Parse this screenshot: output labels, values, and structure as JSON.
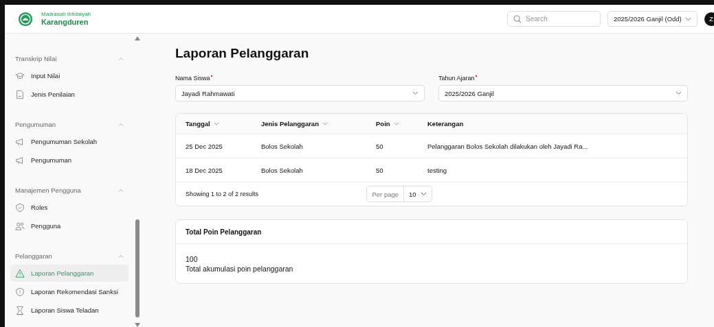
{
  "brand": {
    "line_1": "Madrasah Ibtidaiyah",
    "line_2": "Karangduren"
  },
  "header": {
    "search": {
      "placeholder": "Search"
    },
    "period": "2025/2026 Ganjil (Odd)",
    "avatar": "Z"
  },
  "sidebar": {
    "groups": [
      {
        "title": "Transkrip Nilai",
        "expanded": true,
        "items": [
          {
            "label": "Input Nilai",
            "selected": false
          },
          {
            "label": "Jenis Penilaian",
            "selected": false
          }
        ]
      },
      {
        "title": "Pengumuman",
        "expanded": true,
        "items": [
          {
            "label": "Pengumuman Sekolah",
            "selected": false
          },
          {
            "label": "Pengumuman",
            "selected": false
          }
        ]
      },
      {
        "title": "Manajemen Pengguna",
        "expanded": true,
        "items": [
          {
            "label": "Roles",
            "selected": false
          },
          {
            "label": "Pengguna",
            "selected": false
          }
        ]
      },
      {
        "title": "Pelanggaran",
        "expanded": true,
        "items": [
          {
            "label": "Laporan Pelanggaran",
            "selected": true
          },
          {
            "label": "Laporan Rekomendasi Sanksi",
            "selected": false
          },
          {
            "label": "Laporan Siswa Teladan",
            "selected": false
          }
        ]
      }
    ]
  },
  "page_title": "Laporan Pelanggaran",
  "filters": [
    {
      "label": "Nama Siswa",
      "required": true,
      "value": "Jayadi Rahmawati"
    },
    {
      "label": "Tahun Ajaran",
      "required": true,
      "value": "2025/2026 Ganjil"
    }
  ],
  "table": {
    "columns": [
      {
        "label": "Tanggal",
        "sortable": true
      },
      {
        "label": "Jenis Pelanggaran",
        "sortable": true
      },
      {
        "label": "Poin",
        "sortable": true
      },
      {
        "label": "Keterangan",
        "sortable": false
      }
    ],
    "rows": [
      [
        "25 Dec 2025",
        "Bolos Sekolah",
        "50",
        "Pelanggaran Bolos Sekolah dilakukan oleh Jayadi Ra..."
      ],
      [
        "18 Dec 2025",
        "Bolos Sekolah",
        "50",
        "testing"
      ]
    ],
    "summary": "Showing 1 to 2 of 2 results",
    "per_page_label": "Per page",
    "per_page": "10"
  },
  "total_card": {
    "title": "Total Poin Pelanggaran",
    "value": "100",
    "caption": "Total akumulasi poin pelanggaran"
  }
}
